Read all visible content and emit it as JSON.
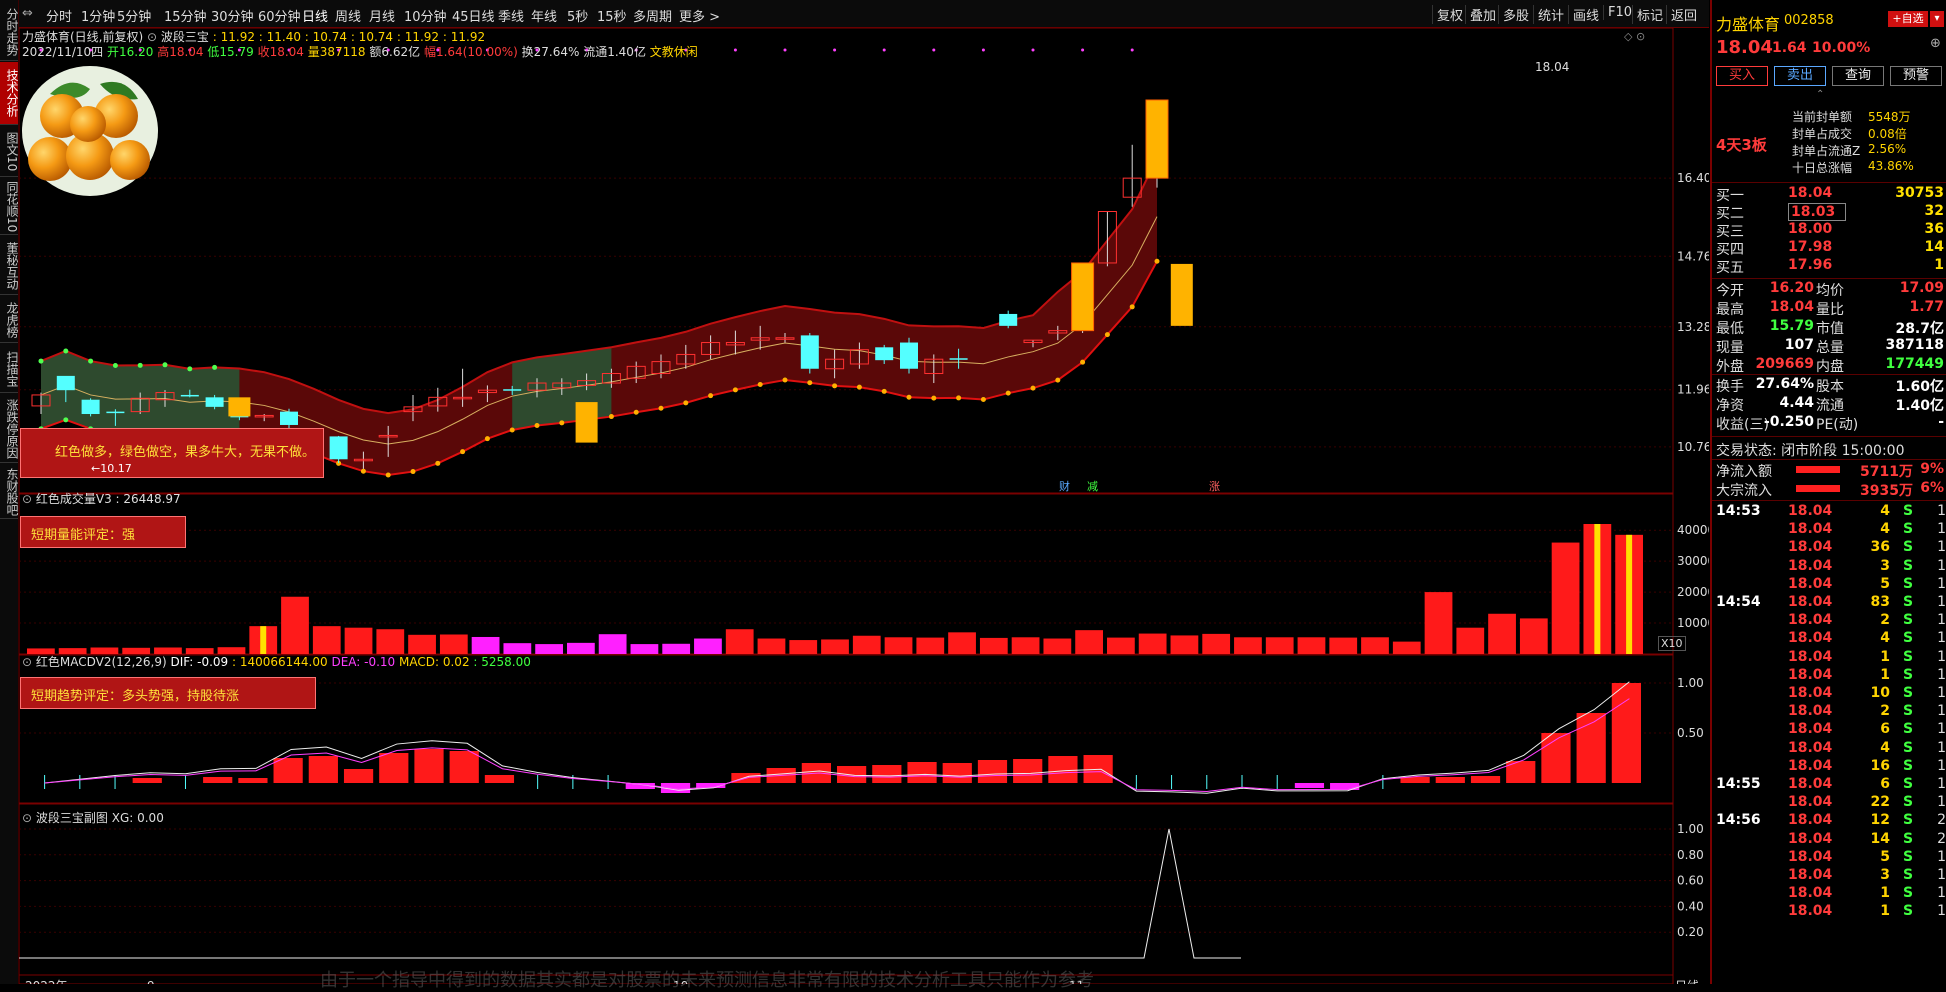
{
  "left_nav": [
    {
      "label": "分时走势",
      "active": false
    },
    {
      "label": "技术分析",
      "active": true
    },
    {
      "label": "图文10",
      "active": false
    },
    {
      "label": "同花顺10",
      "active": false
    },
    {
      "label": "董秘互动",
      "active": false
    },
    {
      "label": "龙虎榜",
      "active": false
    },
    {
      "label": "扫描宝",
      "active": false
    },
    {
      "label": "涨跌停原因",
      "active": false
    },
    {
      "label": "东财股吧",
      "active": false
    }
  ],
  "toolbar": {
    "periods": [
      "分时",
      "1分钟",
      "5分钟",
      "15分钟",
      "30分钟",
      "60分钟",
      "日线",
      "周线",
      "月线",
      "10分钟",
      "45日线",
      "季线",
      "年线",
      "5秒",
      "15秒",
      "多周期",
      "更多 >"
    ],
    "selected": "日线",
    "right_items": [
      "复权",
      "叠加",
      "多股",
      "统计",
      "画线",
      "F10",
      "标记",
      "返回"
    ]
  },
  "main_chart": {
    "title": "力盛体育(日线,前复权)",
    "indicator_name": "波段三宝",
    "indicator_values": ": 11.92 : 11.40 : 10.74 : 10.74 : 11.92 : 11.92",
    "date_line": {
      "date": "2022/11/10四",
      "open": "开16.20",
      "high": "高18.04",
      "low": "低15.79",
      "close": "收18.04",
      "vol": "量387118",
      "amount": "额6.62亿",
      "change": "幅1.64(10.00%)",
      "turnover": "换27.64%",
      "float": "流通1.40亿",
      "industry": "文教休闲"
    },
    "y_ticks": [
      "16.40",
      "14.76",
      "13.28",
      "11.96",
      "10.76"
    ],
    "max_label": "18.04",
    "min_label": "←10.17",
    "note_box": "红色做多，绿色做空，果多牛大，无果不做。",
    "event_markers": [
      "财",
      "减",
      "涨"
    ],
    "candles": [
      {
        "o": 11.62,
        "h": 11.9,
        "l": 11.45,
        "c": 11.85,
        "t": "up"
      },
      {
        "o": 11.95,
        "h": 12.2,
        "l": 11.7,
        "c": 12.25,
        "t": "cyan"
      },
      {
        "o": 11.75,
        "h": 11.78,
        "l": 11.4,
        "c": 11.45,
        "t": "cyan"
      },
      {
        "o": 11.5,
        "h": 11.55,
        "l": 11.2,
        "c": 11.5,
        "t": "cyan"
      },
      {
        "o": 11.5,
        "h": 11.9,
        "l": 11.45,
        "c": 11.78,
        "t": "up"
      },
      {
        "o": 11.75,
        "h": 11.95,
        "l": 11.6,
        "c": 11.9,
        "t": "up"
      },
      {
        "o": 11.85,
        "h": 11.96,
        "l": 11.8,
        "c": 11.85,
        "t": "cyan"
      },
      {
        "o": 11.8,
        "h": 11.85,
        "l": 11.55,
        "c": 11.6,
        "t": "cyan"
      },
      {
        "o": 11.72,
        "h": 11.78,
        "l": 11.32,
        "c": 11.38,
        "t": "cyan"
      },
      {
        "o": 11.42,
        "h": 11.45,
        "l": 11.3,
        "c": 11.42,
        "t": "up"
      },
      {
        "o": 11.5,
        "h": 11.56,
        "l": 10.8,
        "c": 11.22,
        "t": "cyan"
      },
      {
        "o": 10.98,
        "h": 11.0,
        "l": 10.85,
        "c": 10.88,
        "t": "up"
      },
      {
        "o": 10.98,
        "h": 10.99,
        "l": 10.42,
        "c": 10.5,
        "t": "cyan"
      },
      {
        "o": 10.5,
        "h": 10.66,
        "l": 10.3,
        "c": 10.5,
        "t": "up"
      },
      {
        "o": 10.98,
        "h": 11.2,
        "l": 10.55,
        "c": 11.0,
        "t": "up"
      },
      {
        "o": 11.5,
        "h": 11.85,
        "l": 11.3,
        "c": 11.6,
        "t": "up"
      },
      {
        "o": 11.62,
        "h": 12.0,
        "l": 11.5,
        "c": 11.8,
        "t": "up"
      },
      {
        "o": 11.8,
        "h": 12.4,
        "l": 11.6,
        "c": 11.8,
        "t": "up"
      },
      {
        "o": 11.9,
        "h": 12.05,
        "l": 11.7,
        "c": 11.95,
        "t": "up"
      },
      {
        "o": 11.97,
        "h": 12.04,
        "l": 11.85,
        "c": 11.97,
        "t": "cyan"
      },
      {
        "o": 11.95,
        "h": 12.2,
        "l": 11.8,
        "c": 12.1,
        "t": "up"
      },
      {
        "o": 12.0,
        "h": 12.2,
        "l": 11.85,
        "c": 12.1,
        "t": "up"
      },
      {
        "o": 12.05,
        "h": 12.3,
        "l": 11.95,
        "c": 12.15,
        "t": "up"
      },
      {
        "o": 12.1,
        "h": 12.4,
        "l": 12.0,
        "c": 12.3,
        "t": "up"
      },
      {
        "o": 12.2,
        "h": 12.55,
        "l": 12.1,
        "c": 12.45,
        "t": "up"
      },
      {
        "o": 12.3,
        "h": 12.7,
        "l": 12.2,
        "c": 12.55,
        "t": "up"
      },
      {
        "o": 12.5,
        "h": 12.9,
        "l": 12.4,
        "c": 12.7,
        "t": "up"
      },
      {
        "o": 12.7,
        "h": 13.1,
        "l": 12.6,
        "c": 12.95,
        "t": "up"
      },
      {
        "o": 12.9,
        "h": 13.2,
        "l": 12.7,
        "c": 12.95,
        "t": "up"
      },
      {
        "o": 13.0,
        "h": 13.3,
        "l": 12.8,
        "c": 13.05,
        "t": "up"
      },
      {
        "o": 13.05,
        "h": 13.15,
        "l": 12.95,
        "c": 13.05,
        "t": "up"
      },
      {
        "o": 13.1,
        "h": 13.15,
        "l": 12.3,
        "c": 12.4,
        "t": "cyan"
      },
      {
        "o": 12.4,
        "h": 12.8,
        "l": 12.2,
        "c": 12.6,
        "t": "up"
      },
      {
        "o": 12.5,
        "h": 12.95,
        "l": 12.4,
        "c": 12.8,
        "t": "up"
      },
      {
        "o": 12.85,
        "h": 12.9,
        "l": 12.5,
        "c": 12.58,
        "t": "cyan"
      },
      {
        "o": 12.95,
        "h": 13.05,
        "l": 12.3,
        "c": 12.4,
        "t": "cyan"
      },
      {
        "o": 12.6,
        "h": 12.7,
        "l": 12.1,
        "c": 12.3,
        "t": "up"
      },
      {
        "o": 12.62,
        "h": 12.82,
        "l": 12.4,
        "c": 12.62,
        "t": "cyan"
      },
      {
        "o": null,
        "h": null,
        "l": null,
        "c": null,
        "t": "gap"
      },
      {
        "o": 13.55,
        "h": 13.62,
        "l": 13.25,
        "c": 13.3,
        "t": "cyan"
      },
      {
        "o": 13.0,
        "h": 13.0,
        "l": 12.85,
        "c": 12.95,
        "t": "up"
      },
      {
        "o": 13.15,
        "h": 13.3,
        "l": 13.0,
        "c": 13.2,
        "t": "up"
      },
      {
        "o": 13.2,
        "h": 14.62,
        "l": 13.15,
        "c": 14.62,
        "t": "limit"
      },
      {
        "o": 14.62,
        "h": 15.7,
        "l": 14.55,
        "c": 15.7,
        "t": "up"
      },
      {
        "o": 16.0,
        "h": 17.1,
        "l": 15.8,
        "c": 16.4,
        "t": "up"
      },
      {
        "o": 16.4,
        "h": 18.04,
        "l": 16.2,
        "c": 18.04,
        "t": "limit"
      }
    ]
  },
  "volume_panel": {
    "title": "红色成交量V3 : 26448.97",
    "rating_box": "短期量能评定：强",
    "y_ticks": [
      "40000",
      "30000",
      "20000",
      "10000"
    ],
    "multiplier": "X10",
    "bars": [
      1800,
      1900,
      2100,
      2000,
      2100,
      1900,
      2200,
      9000,
      18500,
      9000,
      8500,
      8000,
      6200,
      6300,
      5500,
      3500,
      3200,
      3600,
      6400,
      3200,
      3300,
      5000,
      8000,
      5000,
      4500,
      4700,
      5900,
      5400,
      5300,
      7000,
      5200,
      5400,
      5000,
      7700,
      5300,
      6600,
      6000,
      6500,
      5400,
      5400,
      5400,
      5300,
      5400,
      4000,
      20000,
      8500,
      13000,
      11500,
      36000,
      42000,
      38500
    ],
    "bar_colors": [
      "r",
      "r",
      "r",
      "r",
      "r",
      "r",
      "r",
      "y",
      "r",
      "r",
      "r",
      "r",
      "r",
      "r",
      "m",
      "m",
      "m",
      "m",
      "m",
      "m",
      "m",
      "m",
      "r",
      "r",
      "r",
      "r",
      "r",
      "r",
      "r",
      "r",
      "r",
      "r",
      "r",
      "r",
      "r",
      "r",
      "r",
      "r",
      "r",
      "r",
      "r",
      "r",
      "r",
      "r",
      "r",
      "r",
      "r",
      "r",
      "r",
      "y",
      "y"
    ]
  },
  "macd_panel": {
    "title": "红色MACDV2(12,26,9)",
    "dif": "DIF: -0.09",
    "dif_extra": ": 140066144.00",
    "dea": "DEA: -0.10",
    "macd": "MACD: 0.02",
    "macd_extra": ": 5258.00",
    "rating_box": "短期趋势评定：多头势强，持股待涨",
    "y_ticks": [
      "1.00",
      "0.50"
    ],
    "bars": [
      0.0,
      0.02,
      0.04,
      0.05,
      0.02,
      0.06,
      0.05,
      0.25,
      0.27,
      0.14,
      0.3,
      0.34,
      0.32,
      0.08,
      0.02,
      -0.02,
      -0.04,
      -0.06,
      -0.1,
      -0.05,
      0.1,
      0.15,
      0.2,
      0.17,
      0.18,
      0.21,
      0.2,
      0.23,
      0.24,
      0.27,
      0.28,
      0.03,
      0.01,
      -0.02,
      0.02,
      -0.03,
      -0.05,
      -0.07,
      0.04,
      0.06,
      0.06,
      0.07,
      0.22,
      0.5,
      0.7,
      1.0
    ]
  },
  "sub_panel": {
    "title": "波段三宝副图",
    "value": "XG: 0.00",
    "y_ticks": [
      "1.00",
      "0.80",
      "0.60",
      "0.40",
      "0.20"
    ]
  },
  "date_axis": {
    "labels": [
      "2022年",
      "9",
      "10",
      "11"
    ],
    "right_label": "日线"
  },
  "bottom_text": "由于一个指导中得到的数据其实都是对股票的未来预测信息非常有限的技术分析工具只能作为参考",
  "right_panel": {
    "name": "力盛体育",
    "code": "002858",
    "add_btn": "+自选",
    "price": "18.04",
    "change": "1.64",
    "pct": "10.00%",
    "buttons": [
      "买入",
      "卖出",
      "查询",
      "预警"
    ],
    "board": "4天3板",
    "seal": [
      {
        "label": "当前封单额",
        "value": "5548万"
      },
      {
        "label": "封单占成交",
        "value": "0.08倍"
      },
      {
        "label": "封单占流通Z",
        "value": "2.56%"
      },
      {
        "label": "十日总涨幅",
        "value": "43.86%"
      }
    ],
    "bids": [
      {
        "label": "买一",
        "price": "18.04",
        "vol": "30753"
      },
      {
        "label": "买二",
        "price": "18.03",
        "vol": "32"
      },
      {
        "label": "买三",
        "price": "18.00",
        "vol": "36"
      },
      {
        "label": "买四",
        "price": "17.98",
        "vol": "14"
      },
      {
        "label": "买五",
        "price": "17.96",
        "vol": "1"
      }
    ],
    "stats": [
      {
        "l1": "今开",
        "v1": "16.20",
        "l2": "均价",
        "v2": "17.09"
      },
      {
        "l1": "最高",
        "v1": "18.04",
        "l2": "量比",
        "v2": "1.77"
      },
      {
        "l1": "最低",
        "v1": "15.79",
        "l2": "市值",
        "v2": "28.7亿"
      },
      {
        "l1": "现量",
        "v1": "107",
        "l2": "总量",
        "v2": "387118"
      },
      {
        "l1": "外盘",
        "v1": "209669",
        "l2": "内盘",
        "v2": "177449"
      }
    ],
    "stats2": [
      {
        "l1": "换手",
        "v1": "27.64%",
        "l2": "股本",
        "v2": "1.60亿"
      },
      {
        "l1": "净资",
        "v1": "4.44",
        "l2": "流通",
        "v2": "1.40亿"
      },
      {
        "l1": "收益(三)",
        "v1": "-0.250",
        "l2": "PE(动)",
        "v2": "-"
      }
    ],
    "trade_status": "交易状态: 闭市阶段 15:00:00",
    "flows": [
      {
        "label": "净流入额",
        "value": "5711万",
        "pct": "9%"
      },
      {
        "label": "大宗流入",
        "value": "3935万",
        "pct": "6%"
      }
    ],
    "ticks": [
      {
        "time": "14:53",
        "price": "18.04",
        "vol": "4",
        "bs": "S",
        "n": "1"
      },
      {
        "time": "",
        "price": "18.04",
        "vol": "4",
        "bs": "S",
        "n": "1"
      },
      {
        "time": "",
        "price": "18.04",
        "vol": "36",
        "bs": "S",
        "n": "1"
      },
      {
        "time": "",
        "price": "18.04",
        "vol": "3",
        "bs": "S",
        "n": "1"
      },
      {
        "time": "",
        "price": "18.04",
        "vol": "5",
        "bs": "S",
        "n": "1"
      },
      {
        "time": "14:54",
        "price": "18.04",
        "vol": "83",
        "bs": "S",
        "n": "1"
      },
      {
        "time": "",
        "price": "18.04",
        "vol": "2",
        "bs": "S",
        "n": "1"
      },
      {
        "time": "",
        "price": "18.04",
        "vol": "4",
        "bs": "S",
        "n": "1"
      },
      {
        "time": "",
        "price": "18.04",
        "vol": "1",
        "bs": "S",
        "n": "1"
      },
      {
        "time": "",
        "price": "18.04",
        "vol": "1",
        "bs": "S",
        "n": "1"
      },
      {
        "time": "",
        "price": "18.04",
        "vol": "10",
        "bs": "S",
        "n": "1"
      },
      {
        "time": "",
        "price": "18.04",
        "vol": "2",
        "bs": "S",
        "n": "1"
      },
      {
        "time": "",
        "price": "18.04",
        "vol": "6",
        "bs": "S",
        "n": "1"
      },
      {
        "time": "",
        "price": "18.04",
        "vol": "4",
        "bs": "S",
        "n": "1"
      },
      {
        "time": "",
        "price": "18.04",
        "vol": "16",
        "bs": "S",
        "n": "1"
      },
      {
        "time": "14:55",
        "price": "18.04",
        "vol": "6",
        "bs": "S",
        "n": "1"
      },
      {
        "time": "",
        "price": "18.04",
        "vol": "22",
        "bs": "S",
        "n": "1"
      },
      {
        "time": "14:56",
        "price": "18.04",
        "vol": "12",
        "bs": "S",
        "n": "2"
      },
      {
        "time": "",
        "price": "18.04",
        "vol": "14",
        "bs": "S",
        "n": "2"
      },
      {
        "time": "",
        "price": "18.04",
        "vol": "5",
        "bs": "S",
        "n": "1"
      },
      {
        "time": "",
        "price": "18.04",
        "vol": "3",
        "bs": "S",
        "n": "1"
      },
      {
        "time": "",
        "price": "18.04",
        "vol": "1",
        "bs": "S",
        "n": "1"
      },
      {
        "time": "",
        "price": "18.04",
        "vol": "1",
        "bs": "S",
        "n": "1"
      }
    ]
  },
  "colors": {
    "up": "#ff2020",
    "down": "#54ffff",
    "accent": "#ffd400",
    "panel_border": "#7a0000"
  }
}
